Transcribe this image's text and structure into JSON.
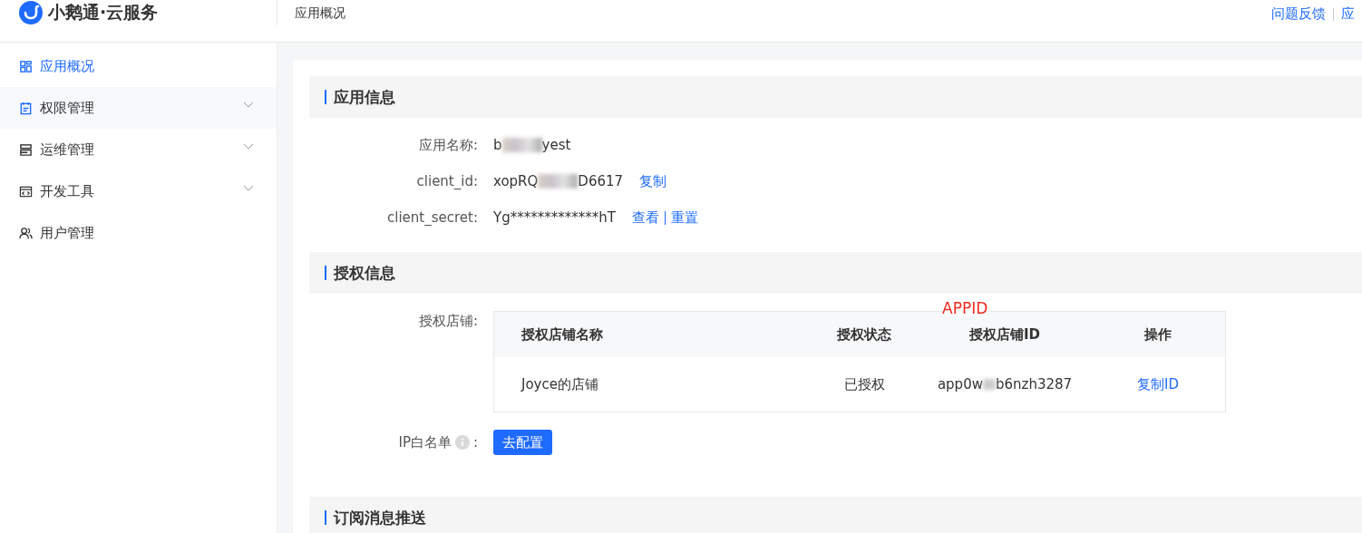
{
  "brand": {
    "name": "小鹅通·云服务"
  },
  "header": {
    "breadcrumb": "应用概况",
    "links": [
      {
        "label": "问题反馈"
      },
      {
        "label": "应"
      }
    ]
  },
  "sidebar": {
    "items": [
      {
        "label": "应用概况",
        "kind": "grid",
        "selected": true,
        "highlighted": false,
        "expandable": false
      },
      {
        "label": "权限管理",
        "kind": "clipboard",
        "selected": false,
        "highlighted": true,
        "expandable": true
      },
      {
        "label": "运维管理",
        "kind": "server",
        "selected": false,
        "highlighted": false,
        "expandable": true
      },
      {
        "label": "开发工具",
        "kind": "code",
        "selected": false,
        "highlighted": false,
        "expandable": true
      },
      {
        "label": "用户管理",
        "kind": "users",
        "selected": false,
        "highlighted": false,
        "expandable": false
      }
    ]
  },
  "app_info": {
    "title": "应用信息",
    "fields": [
      {
        "label": "应用名称:",
        "value_start": "b",
        "value_end": "yest",
        "redacted": true
      },
      {
        "label": "client_id:",
        "value_start": "xopRQ",
        "value_end": "D6617",
        "redacted": true,
        "actions": [
          {
            "label": "复制"
          }
        ]
      },
      {
        "label": "client_secret:",
        "value_start": "Yg*************hT",
        "redacted": false,
        "actions": [
          {
            "label": "查看"
          },
          {
            "label": "重置"
          }
        ]
      }
    ]
  },
  "auth_info": {
    "title": "授权信息",
    "stores_label": "授权店铺:",
    "table": {
      "columns": [
        "授权店铺名称",
        "授权状态",
        "授权店铺ID",
        "操作"
      ],
      "rows": [
        {
          "name": "Joyce的店铺",
          "status": "已授权",
          "id_start": "app0w",
          "id_end": "b6nzh3287",
          "action": "复制ID"
        }
      ]
    },
    "annotation": "APPID",
    "ip_label": "IP白名单",
    "ip_suffix": ":",
    "ip_button": "去配置"
  },
  "subscription": {
    "title": "订阅消息推送"
  }
}
